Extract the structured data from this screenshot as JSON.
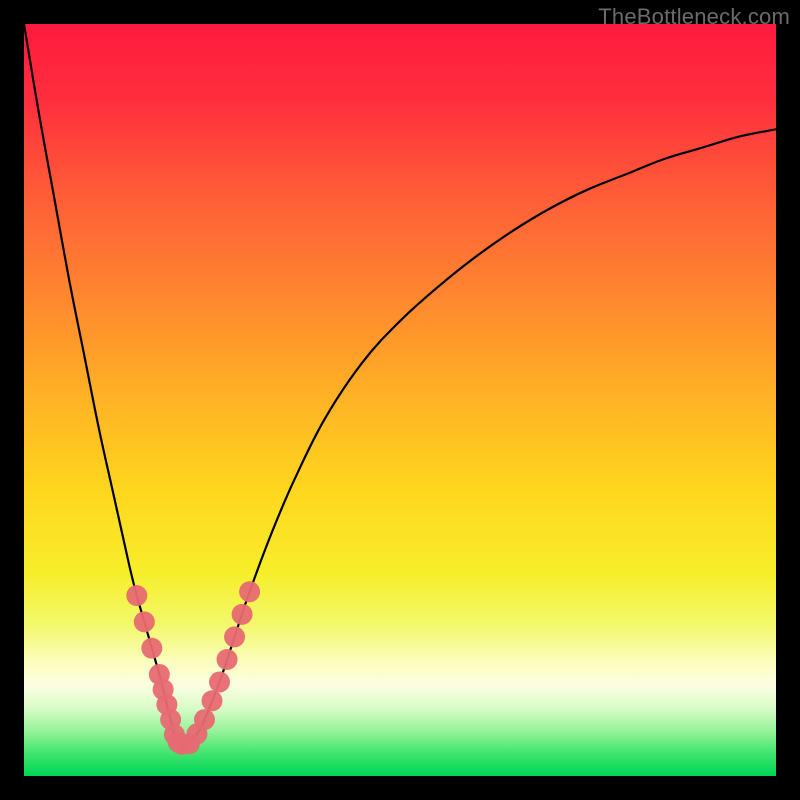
{
  "watermark": "TheBottleneck.com",
  "chart_data": {
    "type": "line",
    "title": "",
    "xlabel": "",
    "ylabel": "",
    "xlim": [
      0,
      100
    ],
    "ylim": [
      0,
      100
    ],
    "grid": false,
    "legend": false,
    "series": [
      {
        "name": "bottleneck-curve",
        "x": [
          0,
          2,
          4,
          6,
          8,
          10,
          12,
          14,
          15,
          16,
          17,
          18,
          18.5,
          19,
          19.5,
          20,
          20.5,
          21,
          22,
          23,
          24,
          26,
          28,
          30,
          33,
          36,
          40,
          45,
          50,
          55,
          60,
          65,
          70,
          75,
          80,
          85,
          90,
          95,
          100
        ],
        "y": [
          100,
          88,
          77,
          66,
          56,
          46,
          37,
          28,
          24,
          20.5,
          17,
          13.5,
          11.5,
          9.5,
          7.5,
          5.5,
          4.5,
          4.2,
          4.3,
          5.6,
          7.5,
          12.5,
          18.5,
          24.5,
          32.5,
          39.5,
          47.5,
          55,
          60.5,
          65,
          69,
          72.5,
          75.5,
          78,
          80,
          82,
          83.5,
          85,
          86
        ]
      }
    ],
    "markers": {
      "name": "highlight-points",
      "color": "#e76a72",
      "points": [
        {
          "x": 15,
          "y": 24
        },
        {
          "x": 16,
          "y": 20.5
        },
        {
          "x": 17,
          "y": 17
        },
        {
          "x": 18,
          "y": 13.5
        },
        {
          "x": 18.5,
          "y": 11.5
        },
        {
          "x": 19,
          "y": 9.5
        },
        {
          "x": 19.5,
          "y": 7.5
        },
        {
          "x": 20,
          "y": 5.5
        },
        {
          "x": 20.5,
          "y": 4.5
        },
        {
          "x": 21,
          "y": 4.2
        },
        {
          "x": 22,
          "y": 4.3
        },
        {
          "x": 23,
          "y": 5.6
        },
        {
          "x": 24,
          "y": 7.5
        },
        {
          "x": 25,
          "y": 10
        },
        {
          "x": 26,
          "y": 12.5
        },
        {
          "x": 27,
          "y": 15.5
        },
        {
          "x": 28,
          "y": 18.5
        },
        {
          "x": 29,
          "y": 21.5
        },
        {
          "x": 30,
          "y": 24.5
        }
      ]
    },
    "background_gradient": {
      "direction": "vertical",
      "stops": [
        {
          "pos": 0.0,
          "color": "#ff1a3f"
        },
        {
          "pos": 0.1,
          "color": "#ff2e3e"
        },
        {
          "pos": 0.22,
          "color": "#ff5a38"
        },
        {
          "pos": 0.35,
          "color": "#ff8330"
        },
        {
          "pos": 0.5,
          "color": "#ffb325"
        },
        {
          "pos": 0.62,
          "color": "#ffd61e"
        },
        {
          "pos": 0.73,
          "color": "#f7ee2a"
        },
        {
          "pos": 0.8,
          "color": "#f2f96d"
        },
        {
          "pos": 0.85,
          "color": "#fcfdc0"
        },
        {
          "pos": 0.88,
          "color": "#fbfee2"
        },
        {
          "pos": 0.91,
          "color": "#d8fcc8"
        },
        {
          "pos": 0.94,
          "color": "#97f29a"
        },
        {
          "pos": 0.97,
          "color": "#3fe56e"
        },
        {
          "pos": 1.0,
          "color": "#00d455"
        }
      ]
    }
  }
}
